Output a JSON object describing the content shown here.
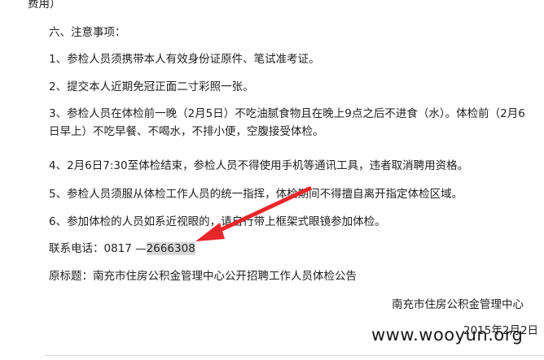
{
  "header_fragment": "费用）",
  "section_title": "六、注意事项：",
  "items": [
    "1、参检人员须携带本人有效身份证原件、笔试准考证。",
    "2、提交本人近期免冠正面二寸彩照一张。",
    "3、参检人员在体检前一晚（2月5日）不吃油腻食物且在晚上9点之后不进食（水）。体检前（2月6日早上）不吃早餐、不喝水，不排小便，空腹接受体检。",
    "4、2月6日7:30至体检结束，参检人员不得使用手机等通讯工具，违者取消聘用资格。",
    "5、参检人员须服从体检工作人员的统一指挥，体检期间不得擅自离开指定体检区域。",
    "6、参加体检的人员如系近视眼的，请自行带上框架式眼镜参加体检。"
  ],
  "contact": {
    "label": "联系电话：0817 —",
    "number": "2666308"
  },
  "original_title": "原标题：南充市住房公积金管理中心公开招聘工作人员体检公告",
  "signature": "南充市住房公积金管理中心",
  "date": "2015年2月2日",
  "watermark": "www.wooyun.org",
  "colors": {
    "arrow": "#e8262b",
    "highlight": "#d9d9d9"
  }
}
